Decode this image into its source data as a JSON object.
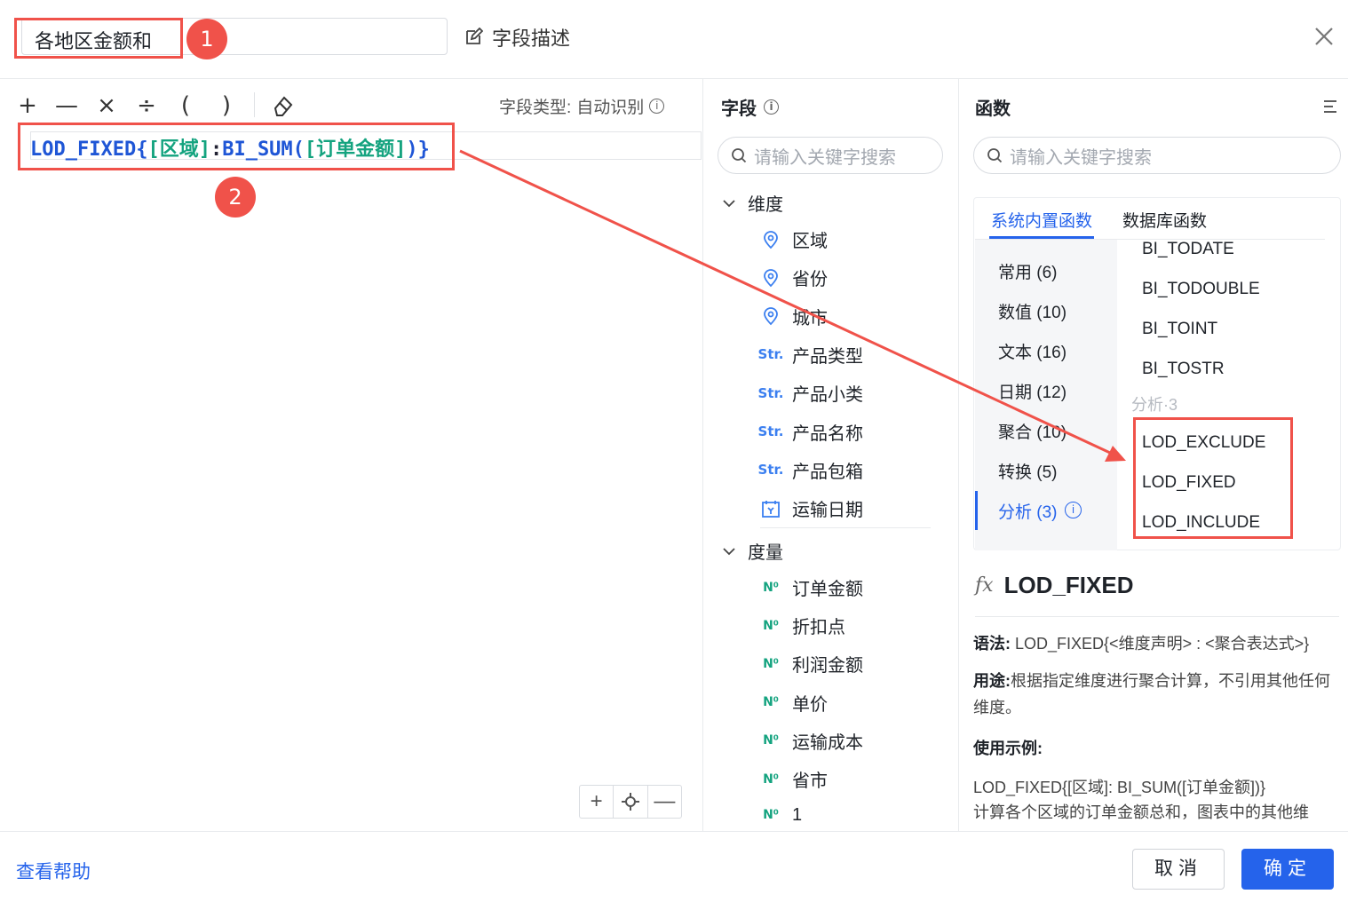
{
  "header": {
    "field_name": "各地区金额和",
    "desc_label": "字段描述",
    "badge1": "1",
    "badge2": "2"
  },
  "toolbar": {
    "ops": [
      "+",
      "—",
      "×",
      "÷",
      "(",
      ")"
    ],
    "type_label": "字段类型:",
    "type_value": "自动识别"
  },
  "editor": {
    "formula_parts": [
      "LOD_FIXED{",
      "[区域]",
      ":",
      "BI_SUM(",
      "[订单金额]",
      ")}"
    ]
  },
  "fields": {
    "title": "字段",
    "search_placeholder": "请输入关键字搜索",
    "dimension_label": "维度",
    "dimensions": [
      {
        "icon": "location-icon",
        "label": "区域"
      },
      {
        "icon": "location-icon",
        "label": "省份"
      },
      {
        "icon": "location-icon",
        "label": "城市"
      },
      {
        "icon": "string-icon",
        "label": "产品类型"
      },
      {
        "icon": "string-icon",
        "label": "产品小类"
      },
      {
        "icon": "string-icon",
        "label": "产品名称"
      },
      {
        "icon": "string-icon",
        "label": "产品包箱"
      },
      {
        "icon": "date-icon",
        "label": "运输日期"
      }
    ],
    "measure_label": "度量",
    "measures": [
      {
        "icon": "number-icon",
        "label": "订单金额"
      },
      {
        "icon": "number-icon",
        "label": "折扣点"
      },
      {
        "icon": "number-icon",
        "label": "利润金额"
      },
      {
        "icon": "number-icon",
        "label": "单价"
      },
      {
        "icon": "number-icon",
        "label": "运输成本"
      },
      {
        "icon": "calc-number-icon",
        "label": "省市"
      },
      {
        "icon": "calc-number-icon",
        "label": "1"
      }
    ],
    "str_glyph": "Str.",
    "num_glyph": "N⁰"
  },
  "functions": {
    "title": "函数",
    "search_placeholder": "请输入关键字搜索",
    "tabs": [
      "系统内置函数",
      "数据库函数"
    ],
    "categories": [
      "常用 (6)",
      "数值 (10)",
      "文本 (16)",
      "日期 (12)",
      "聚合 (10)",
      "转换 (5)",
      "分析 (3)"
    ],
    "list_top": [
      "BI_TODATE",
      "BI_TODOUBLE",
      "BI_TOINT",
      "BI_TOSTR"
    ],
    "group_label": "分析·3",
    "list_lod": [
      "LOD_EXCLUDE",
      "LOD_FIXED",
      "LOD_INCLUDE"
    ],
    "detail": {
      "fx": "fx",
      "name": "LOD_FIXED",
      "syntax_label": "语法:",
      "syntax": "LOD_FIXED{<维度声明> : <聚合表达式>}",
      "usage_label": "用途:",
      "usage": "根据指定维度进行聚合计算，不引用其他任何维度。",
      "example_label": "使用示例:",
      "example_code": "LOD_FIXED{[区域]: BI_SUM([订单金额])}",
      "example_desc": "计算各个区域的订单金额总和，图表中的其他维"
    }
  },
  "footer": {
    "help": "查看帮助",
    "cancel": "取消",
    "ok": "确定"
  },
  "colors": {
    "accent": "#2563eb",
    "annotation_red": "#f0524a",
    "formula_blue": "#1f56d6",
    "formula_green": "#14a37f"
  }
}
